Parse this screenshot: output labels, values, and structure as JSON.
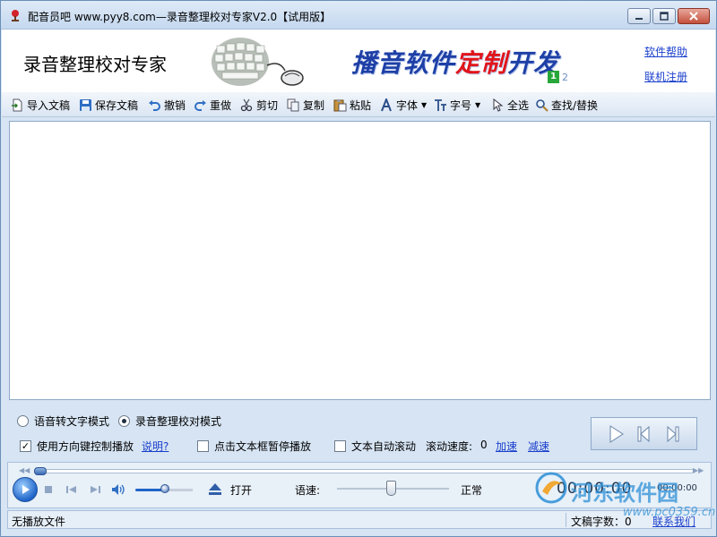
{
  "window": {
    "title": "配音员吧 www.pyy8.com—录音整理校对专家V2.0【试用版】"
  },
  "banner": {
    "app_title": "录音整理校对专家",
    "slogan_part1": "播音软件",
    "slogan_part2": "定制",
    "slogan_part3": "开发",
    "badge": "12",
    "help_link": "软件帮助",
    "register_link": "联机注册"
  },
  "toolbar": {
    "import": "导入文稿",
    "save": "保存文稿",
    "undo": "撤销",
    "redo": "重做",
    "cut": "剪切",
    "copy": "复制",
    "paste": "粘贴",
    "font": "字体",
    "font_size": "字号",
    "select_all": "全选",
    "find_replace": "查找/替换"
  },
  "editor": {
    "content": ""
  },
  "options": {
    "mode_speech_to_text": "语音转文字模式",
    "mode_proofread": "录音整理校对模式",
    "selected_mode": "proofread",
    "arrow_keys_control": "使用方向键控制播放",
    "arrow_keys_checked": true,
    "explain_link": "说明?",
    "click_pause": "点击文本框暂停播放",
    "click_pause_checked": false,
    "auto_scroll": "文本自动滚动",
    "auto_scroll_checked": false,
    "scroll_speed_label": "滚动速度:",
    "scroll_speed_value": "0",
    "speed_up": "加速",
    "speed_down": "减速"
  },
  "player": {
    "open_label": "打开",
    "rate_label": "语速:",
    "rate_value": "正常",
    "current_time": "00:00:00",
    "total_time": "00:00:00",
    "progress": 0,
    "volume": 0.5
  },
  "status": {
    "file_status": "无播放文件",
    "word_count_label": "文稿字数：0",
    "contact_link": "联系我们"
  },
  "watermark": {
    "site_name": "河东软件园",
    "url": "www.pc0359.cn"
  },
  "colors": {
    "window_bg": "#d6e4f3",
    "accent_blue": "#1d3fa6",
    "accent_red": "#e0151b",
    "link": "#1a3fcc"
  }
}
